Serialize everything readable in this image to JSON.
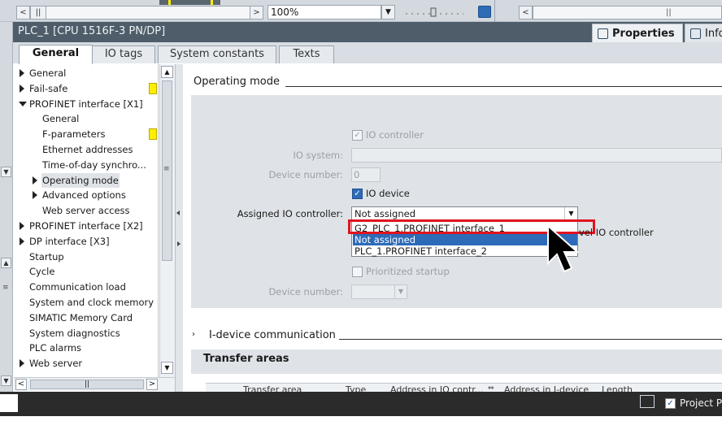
{
  "toolbar": {
    "zoom": "100%",
    "nav_left": "<",
    "nav_right": ">",
    "nav_pause": "||"
  },
  "window": {
    "title": "PLC_1 [CPU 1516F-3 PN/DP]",
    "inspector_tabs": [
      "Properties",
      "Info"
    ]
  },
  "tabs": [
    "General",
    "IO tags",
    "System constants",
    "Texts"
  ],
  "nav": {
    "items": [
      {
        "label": "General",
        "level": 0,
        "arrow": "right"
      },
      {
        "label": "Fail-safe",
        "level": 0,
        "arrow": "right",
        "marked": true
      },
      {
        "label": "PROFINET interface [X1]",
        "level": 0,
        "arrow": "down"
      },
      {
        "label": "General",
        "level": 1,
        "arrow": ""
      },
      {
        "label": "F-parameters",
        "level": 1,
        "arrow": "",
        "marked": true
      },
      {
        "label": "Ethernet addresses",
        "level": 1,
        "arrow": ""
      },
      {
        "label": "Time-of-day synchro...",
        "level": 1,
        "arrow": ""
      },
      {
        "label": "Operating mode",
        "level": 1,
        "arrow": "right",
        "selected": true
      },
      {
        "label": "Advanced options",
        "level": 1,
        "arrow": "right"
      },
      {
        "label": "Web server access",
        "level": 1,
        "arrow": ""
      },
      {
        "label": "PROFINET interface [X2]",
        "level": 0,
        "arrow": "right"
      },
      {
        "label": "DP interface [X3]",
        "level": 0,
        "arrow": "right"
      },
      {
        "label": "Startup",
        "level": 0,
        "arrow": ""
      },
      {
        "label": "Cycle",
        "level": 0,
        "arrow": ""
      },
      {
        "label": "Communication load",
        "level": 0,
        "arrow": ""
      },
      {
        "label": "System and clock memory",
        "level": 0,
        "arrow": ""
      },
      {
        "label": "SIMATIC Memory Card",
        "level": 0,
        "arrow": ""
      },
      {
        "label": "System diagnostics",
        "level": 0,
        "arrow": ""
      },
      {
        "label": "PLC alarms",
        "level": 0,
        "arrow": ""
      },
      {
        "label": "Web server",
        "level": 0,
        "arrow": "right"
      }
    ]
  },
  "content": {
    "section_title": "Operating mode",
    "io_controller_label": "IO controller",
    "io_system_label": "IO system:",
    "device_number_label": "Device number:",
    "device_number_value": "0",
    "io_device_label": "IO device",
    "assigned_label": "Assigned IO controller:",
    "assigned_value": "Not assigned",
    "dropdown_options": [
      "G2_PLC_1.PROFINET interface_1",
      "Not assigned",
      "PLC_1.PROFINET interface_2"
    ],
    "dropdown_selected_index": 1,
    "controller_tail": "vel IO controller",
    "prioritized_label": "Prioritized startup",
    "device_number2_label": "Device number:",
    "idevice_label": "I-device communication",
    "transfer_title": "Transfer areas",
    "table_headers": [
      "Transfer area",
      "Type",
      "Address in IO contr...",
      "Address in I-device",
      "Length"
    ]
  },
  "status": {
    "project_label": "Project Pro"
  },
  "colors": {
    "title_bar": "#4e5d69",
    "selection_blue": "#2d6bb8",
    "highlight_red": "#e0141e",
    "marker_yellow": "#ffee00"
  }
}
